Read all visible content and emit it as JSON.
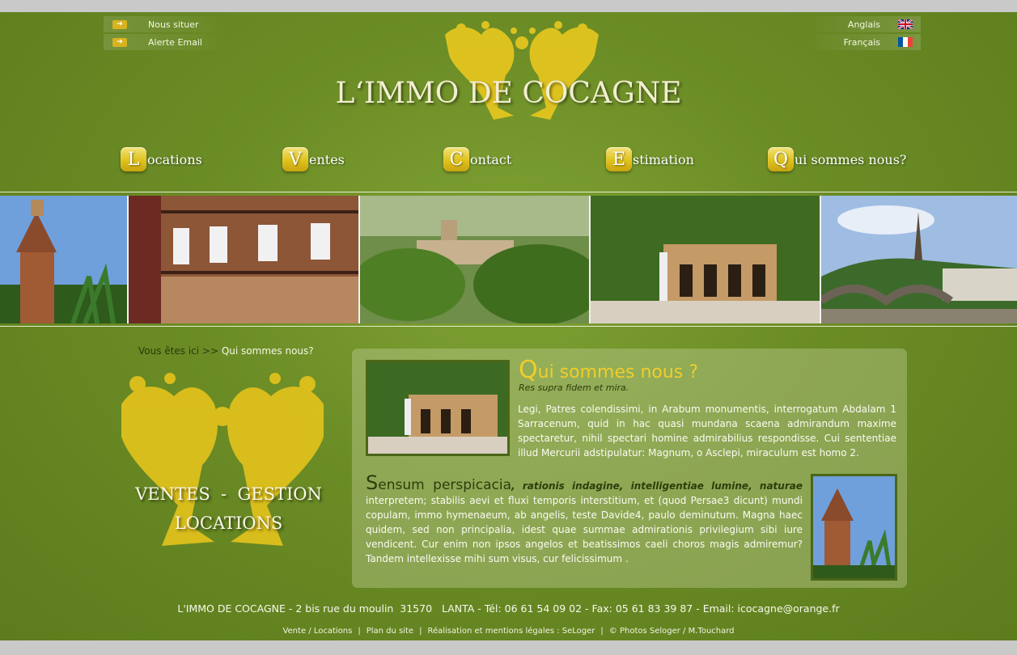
{
  "header": {
    "top_links": [
      {
        "label": "Nous situer",
        "icon": "arrow-right-icon"
      },
      {
        "label": "Alerte Email",
        "icon": "arrow-right-icon"
      }
    ],
    "languages": [
      {
        "label": "Anglais",
        "icon": "uk-flag-icon"
      },
      {
        "label": "Français",
        "icon": "france-flag-icon"
      }
    ],
    "logo_text": "L‘IMMO DE COCAGNE"
  },
  "nav": [
    {
      "letter": "L",
      "rest": "ocations"
    },
    {
      "letter": "V",
      "rest": "entes"
    },
    {
      "letter": "C",
      "rest": "ontact"
    },
    {
      "letter": "E",
      "rest": "stimation"
    },
    {
      "letter": "Q",
      "rest": "ui sommes nous?"
    }
  ],
  "breadcrumb": {
    "prefix": "Vous êtes ici >>",
    "current": "Qui sommes nous?"
  },
  "slogan": {
    "line1": "VENTES  -  GESTION",
    "line2": "LOCATIONS"
  },
  "content": {
    "title_first": "Q",
    "title_rest": "ui sommes nous ?",
    "subtitle": "Res supra fidem et mira.",
    "para1": "Legi, Patres colendissimi, in Arabum monumentis, interrogatum Abdalam 1 Sarracenum, quid in hac quasi mundana scaena admirandum maxime spectaretur, nihil spectari homine admirabilius respondisse. Cui sententiae illud Mercurii adstipulatur: Magnum, o Asclepi, miraculum est homo 2.",
    "para2_first": "S",
    "para2_lead": "ensum perspicacia",
    "para2_bold": "rationis indagine, intelligentiae lumine, naturae",
    "para2_rest": "interpretem; stabilis aevi et fluxi temporis interstitium, et (quod Persae3 dicunt) mundi copulam, immo hymenaeum, ab angelis, teste Davide4, paulo deminutum. Magna haec quidem, sed non principalia, idest quae summae admirationis privilegium sibi iure vendicent. Cur enim non ipsos angelos et beatissimos caeli choros magis admiremur? Tandem intellexisse mihi sum visus, cur felicissimum ."
  },
  "footer": {
    "address": "L'IMMO DE COCAGNE - 2 bis rue du moulin  31570   LANTA - Tél: 06 61 54 09 02 - Fax: 05 61 83 39 87 - Email: icocagne@orange.fr",
    "links": [
      "Vente / Locations",
      "Plan du site",
      "Réalisation et mentions légales : SeLoger",
      "© Photos Seloger / M.Touchard"
    ]
  },
  "colors": {
    "background": "#6b8c25",
    "accent": "#f1cd2a",
    "dark_text": "#2d3d0b"
  }
}
